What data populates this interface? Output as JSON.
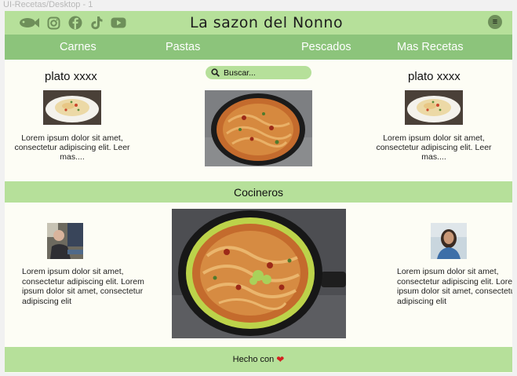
{
  "window": {
    "title": "UI-Recetas/Desktop - 1"
  },
  "header": {
    "brand": "La sazon del Nonno",
    "social_icons": [
      "fish-icon",
      "instagram-icon",
      "facebook-icon",
      "tiktok-icon",
      "youtube-icon"
    ],
    "menu_icon": "hamburger-menu-icon"
  },
  "nav": {
    "items": [
      "Carnes",
      "Pastas",
      "Pescados",
      "Mas Recetas"
    ]
  },
  "search": {
    "placeholder": "Buscar..."
  },
  "dishes": [
    {
      "title": "plato xxxx",
      "text": "Lorem ipsum dolor sit amet, consectetur adipiscing elit. Leer mas...."
    },
    {
      "title": "plato xxxx",
      "text": "Lorem ipsum dolor sit amet, consectetur adipiscing elit. Leer mas...."
    }
  ],
  "cooks": {
    "heading": "Cocineros",
    "items": [
      {
        "text": "Lorem ipsum dolor sit amet, consectetur adipiscing elit. Lorem ipsum dolor sit amet, consectetur adipiscing elit"
      },
      {
        "text": "Lorem ipsum dolor sit amet, consectetur adipiscing elit. Lorem ipsum dolor sit amet, consectetur adipiscing elit"
      }
    ]
  },
  "footer": {
    "text": "Hecho con",
    "heart_icon": "heart-icon"
  },
  "colors": {
    "light_green": "#b6e09a",
    "nav_green": "#8cc47b",
    "background": "#fdfdf5"
  }
}
